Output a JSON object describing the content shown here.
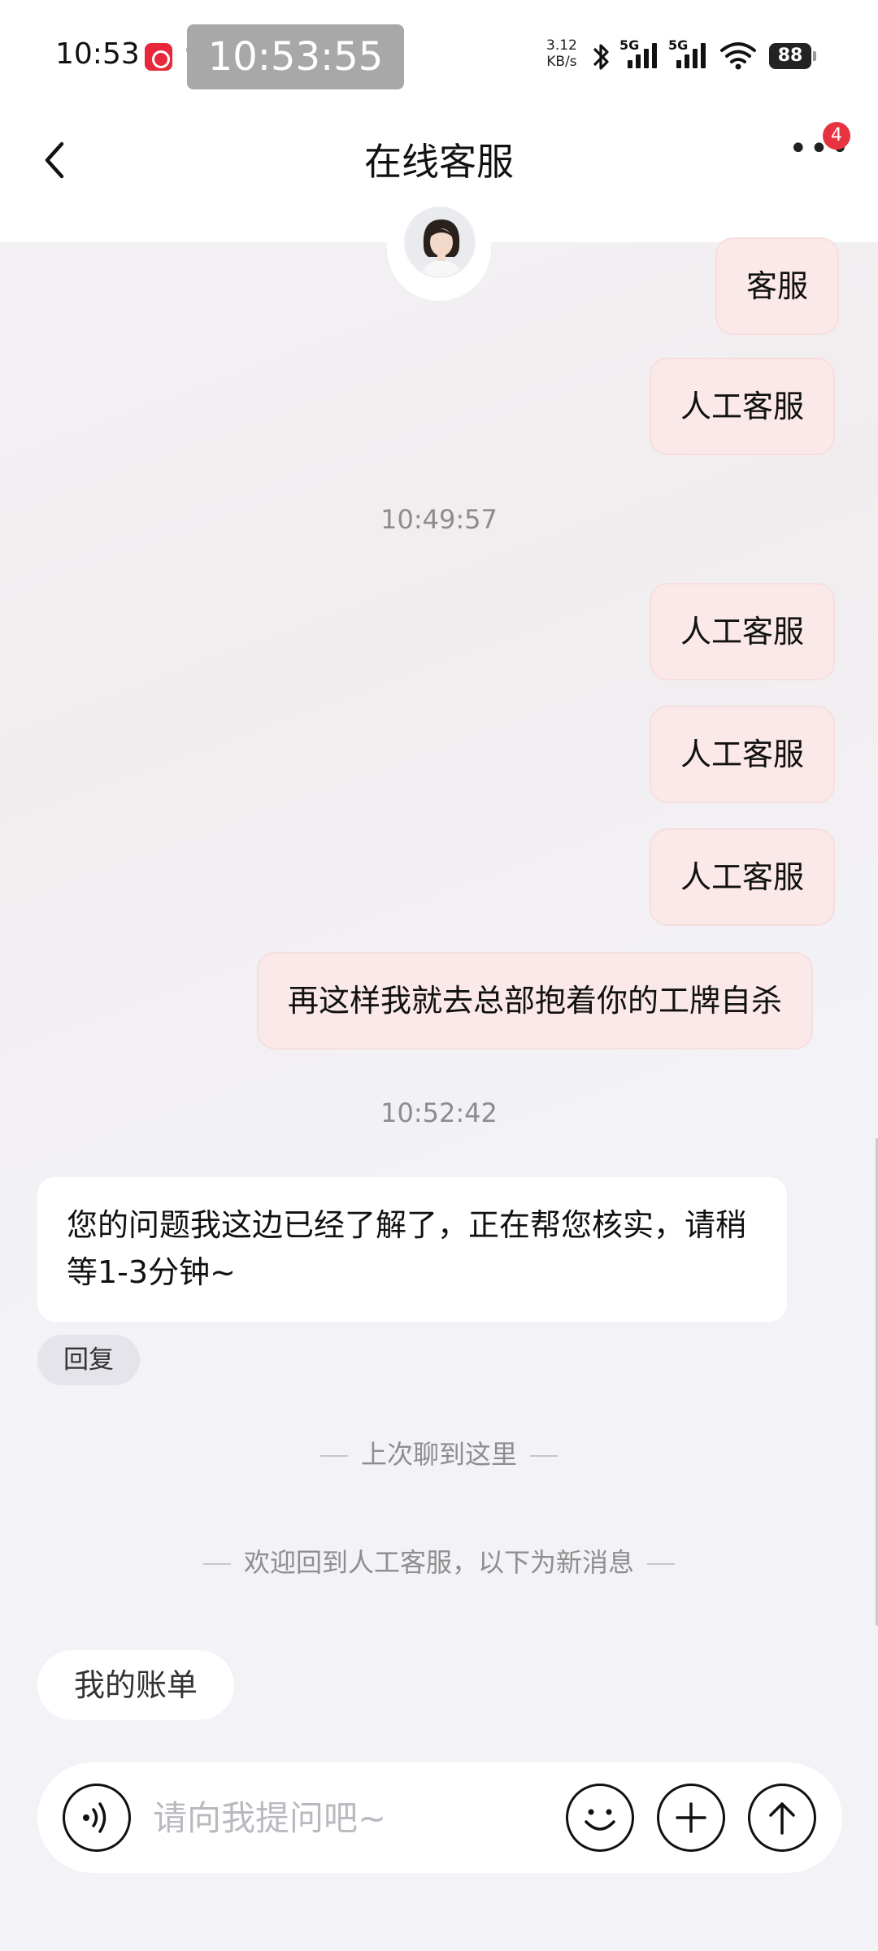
{
  "status_bar": {
    "time": "10:53",
    "overlay_clock": "10:53:55",
    "net_speed_value": "3.12",
    "net_speed_unit": "KB/s",
    "sim1_label": "5G",
    "sim2_label": "5G",
    "battery": "88"
  },
  "header": {
    "title": "在线客服",
    "badge_count": "4"
  },
  "messages": {
    "msg1": "客服",
    "msg2": "人工客服",
    "time1": "10:49:57",
    "msg3": "人工客服",
    "msg4": "人工客服",
    "msg5": "人工客服",
    "msg6": "再这样我就去总部抱着你的工牌自杀",
    "time2": "10:52:42",
    "agent_reply": "您的问题我这边已经了解了，正在帮您核实，请稍等1-3分钟~",
    "reply_chip": "回复",
    "last_chat_note": "上次聊到这里",
    "welcome_note": "欢迎回到人工客服，以下为新消息"
  },
  "quick_actions": {
    "my_bill": "我的账单"
  },
  "input": {
    "placeholder": "请向我提问吧~"
  },
  "colors": {
    "user_bubble": "#fbe9e9",
    "badge": "#e8323f",
    "app_icon": "#e8283a"
  }
}
